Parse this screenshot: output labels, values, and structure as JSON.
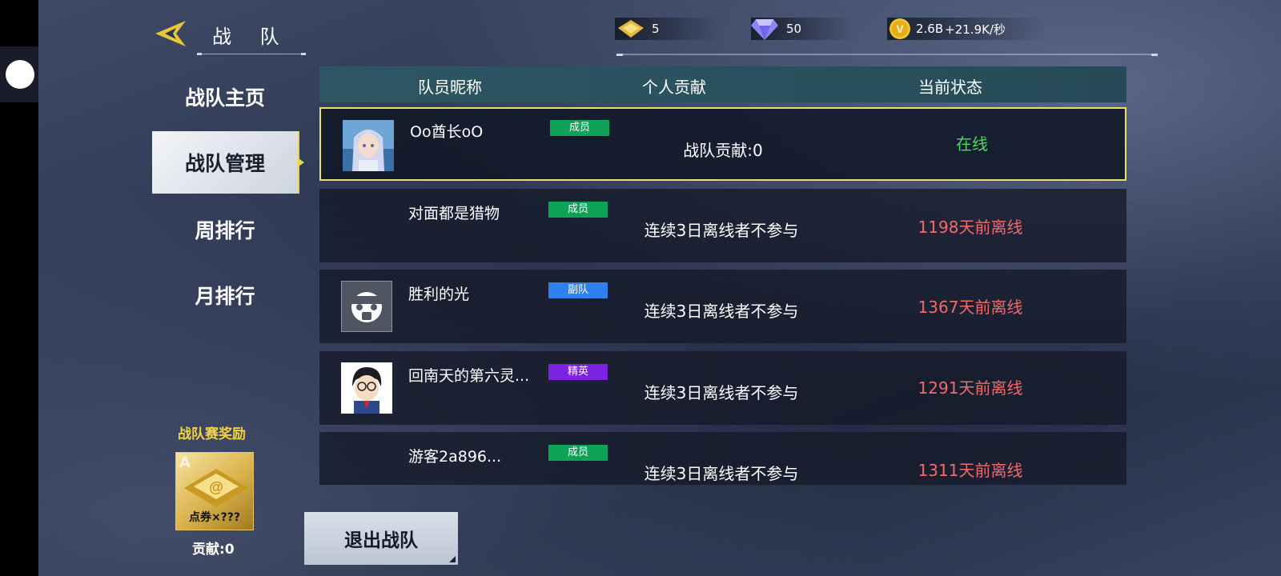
{
  "header": {
    "title": "战 队",
    "currencies": [
      {
        "icon": "coupon-icon",
        "value": "5"
      },
      {
        "icon": "diamond-icon",
        "value": "50"
      },
      {
        "icon": "gold-coin-icon",
        "value": "2.6B",
        "rate": "+21.9K/秒"
      }
    ]
  },
  "sidebar": {
    "tabs": [
      {
        "label": "战队主页",
        "active": false
      },
      {
        "label": "战队管理",
        "active": true
      },
      {
        "label": "周排行",
        "active": false
      },
      {
        "label": "月排行",
        "active": false
      }
    ]
  },
  "reward": {
    "title": "战队赛奖励",
    "grade": "A",
    "item_label": "点券×???",
    "contribution": "贡献:0"
  },
  "table": {
    "headers": [
      "队员昵称",
      "个人贡献",
      "当前状态"
    ],
    "rows": [
      {
        "name": "Oo酋长oO",
        "role": "成员",
        "role_color": "#0fa35a",
        "contribution": "战队贡献:0",
        "status": "在线",
        "status_color": "#4cd964",
        "avatar": "anime-girl-avatar"
      },
      {
        "name": "对面都是猎物",
        "role": "成员",
        "role_color": "#0fa35a",
        "contribution": "连续3日离线者不参与",
        "status": "1198天前离线",
        "status_color": "#f06b6b",
        "avatar": ""
      },
      {
        "name": "胜利的光",
        "role": "副队",
        "role_color": "#2f7ff0",
        "contribution": "连续3日离线者不参与",
        "status": "1367天前离线",
        "status_color": "#f06b6b",
        "avatar": "gas-mask-avatar"
      },
      {
        "name": "回南天的第六灵...",
        "role": "精英",
        "role_color": "#7d22e0",
        "contribution": "连续3日离线者不参与",
        "status": "1291天前离线",
        "status_color": "#f06b6b",
        "avatar": "detective-avatar"
      },
      {
        "name": "游客2a896...",
        "role": "成员",
        "role_color": "#0fa35a",
        "contribution": "连续3日离线者不参与",
        "status": "1311天前离线",
        "status_color": "#f06b6b",
        "avatar": ""
      }
    ]
  },
  "footer": {
    "exit_label": "退出战队"
  }
}
